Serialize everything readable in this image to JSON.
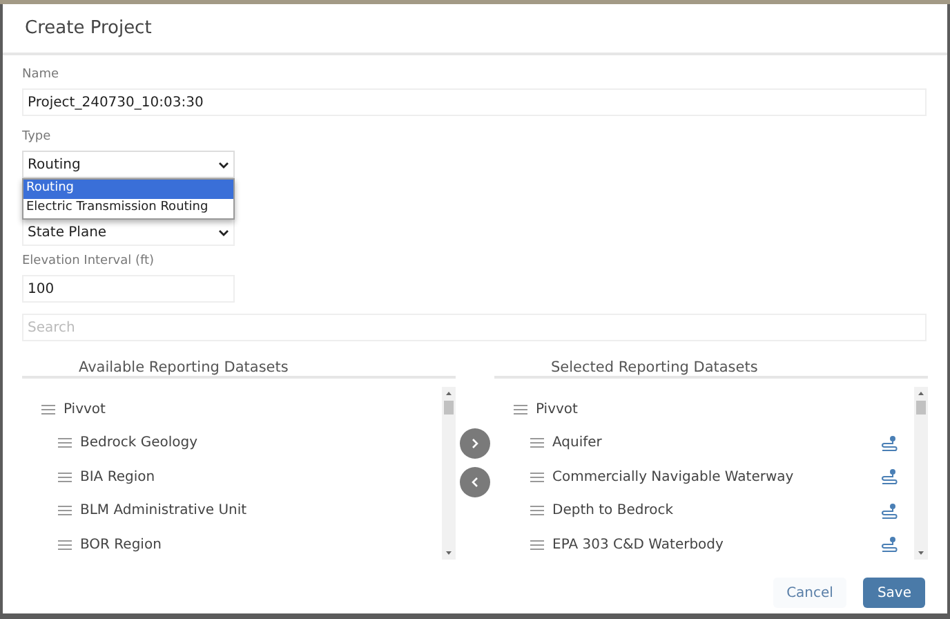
{
  "dialog": {
    "title": "Create Project"
  },
  "fields": [
    {
      "kind": "text",
      "label": "Name",
      "value": "Project_240730_10:03:30",
      "wide": true
    },
    {
      "kind": "select",
      "label": "Type",
      "value": "Routing",
      "open": true,
      "options": [
        {
          "label": "Routing",
          "selected": true
        },
        {
          "label": "Electric Transmission Routing",
          "selected": false
        }
      ]
    },
    {
      "kind": "select",
      "value": "State Plane",
      "open": false
    },
    {
      "kind": "text",
      "label": "Elevation Interval (ft)",
      "value": "100",
      "wide": false
    }
  ],
  "search": {
    "placeholder": "Search"
  },
  "lists": [
    {
      "title": "Available Reporting Datasets",
      "items": [
        {
          "label": "Pivvot",
          "children": [
            {
              "label": "Bedrock Geology",
              "route_icon": false
            },
            {
              "label": "BIA Region",
              "route_icon": false
            },
            {
              "label": "BLM Administrative Unit",
              "route_icon": false
            },
            {
              "label": "BOR Region",
              "route_icon": false
            }
          ]
        }
      ]
    },
    {
      "title": "Selected Reporting Datasets",
      "items": [
        {
          "label": "Pivvot",
          "children": [
            {
              "label": "Aquifer",
              "route_icon": true
            },
            {
              "label": "Commercially Navigable Waterway",
              "route_icon": true
            },
            {
              "label": "Depth to Bedrock",
              "route_icon": true
            },
            {
              "label": "EPA 303 C&D Waterbody",
              "route_icon": true
            }
          ]
        }
      ]
    }
  ],
  "buttons": [
    {
      "label": "Cancel",
      "kind": "secondary"
    },
    {
      "label": "Save",
      "kind": "primary"
    }
  ]
}
